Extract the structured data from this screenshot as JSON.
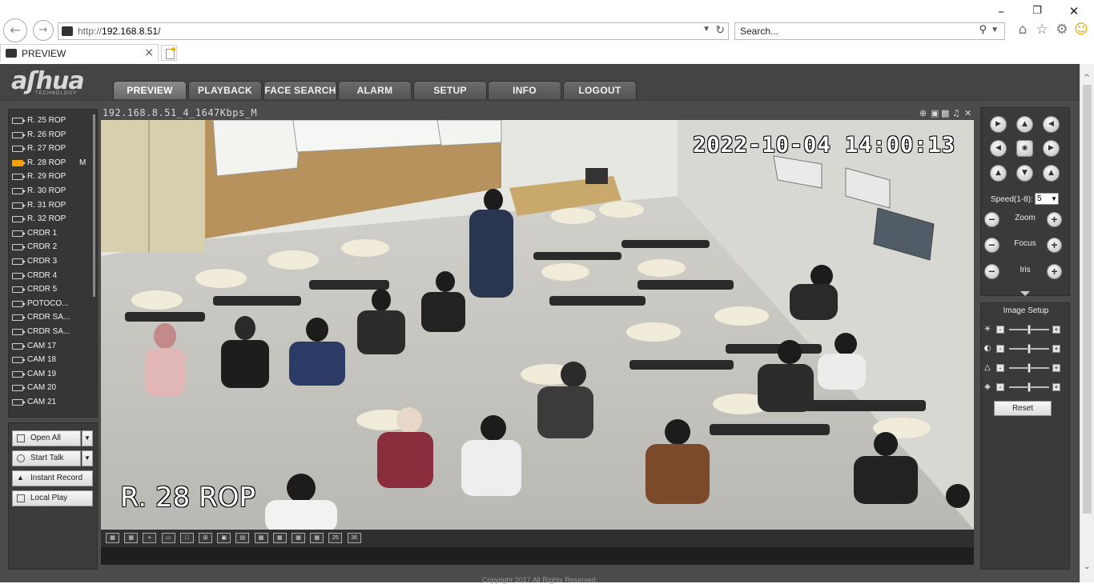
{
  "browser": {
    "url_prefix": "http://",
    "url_host": "192.168.8.51",
    "url_suffix": "/",
    "search_placeholder": "Search...",
    "tab_title": "PREVIEW"
  },
  "logo": {
    "brand": "aʃhua",
    "sub": "TECHNOLOGY"
  },
  "main_tabs": [
    "PREVIEW",
    "PLAYBACK",
    "FACE SEARCH",
    "ALARM",
    "SETUP",
    "INFO",
    "LOGOUT"
  ],
  "devices": [
    {
      "label": "R. 25 ROP",
      "mark": ""
    },
    {
      "label": "R. 26 ROP",
      "mark": ""
    },
    {
      "label": "R. 27 ROP",
      "mark": ""
    },
    {
      "label": "R. 28 ROP",
      "mark": "M"
    },
    {
      "label": "R. 29 ROP",
      "mark": ""
    },
    {
      "label": "R. 30 ROP",
      "mark": ""
    },
    {
      "label": "R. 31 ROP",
      "mark": ""
    },
    {
      "label": "R. 32 ROP",
      "mark": ""
    },
    {
      "label": "CRDR 1",
      "mark": ""
    },
    {
      "label": "CRDR 2",
      "mark": ""
    },
    {
      "label": "CRDR 3",
      "mark": ""
    },
    {
      "label": "CRDR 4",
      "mark": ""
    },
    {
      "label": "CRDR 5",
      "mark": ""
    },
    {
      "label": "POTOCO...",
      "mark": ""
    },
    {
      "label": "CRDR SA...",
      "mark": ""
    },
    {
      "label": "CRDR SA...",
      "mark": ""
    },
    {
      "label": "CAM 17",
      "mark": ""
    },
    {
      "label": "CAM 18",
      "mark": ""
    },
    {
      "label": "CAM 19",
      "mark": ""
    },
    {
      "label": "CAM 20",
      "mark": ""
    },
    {
      "label": "CAM 21",
      "mark": ""
    }
  ],
  "actions": {
    "open_all": "Open All",
    "start_talk": "Start Talk",
    "instant_record": "Instant Record",
    "local_play": "Local Play"
  },
  "video": {
    "title": "192.168.8.51_4_1647Kbps_M",
    "osd_time": "2022-10-04 14:00:13",
    "osd_name": "R. 28 ROP"
  },
  "layout_buttons": [
    "",
    "",
    "",
    "",
    "",
    "",
    "",
    "",
    "",
    "",
    "",
    "",
    "25",
    "36"
  ],
  "ptz": {
    "speed_label": "Speed(1-8):",
    "speed_value": "5",
    "zoom": "Zoom",
    "focus": "Focus",
    "iris": "Iris"
  },
  "image_setup": {
    "title": "Image Setup",
    "reset": "Reset"
  },
  "footer": "Copyright 2017 All Rights Reserved."
}
